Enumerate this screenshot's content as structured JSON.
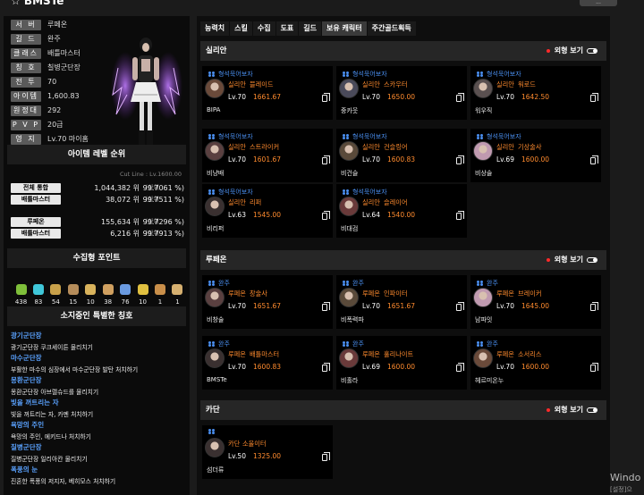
{
  "top": {
    "title": "☆ BMSTe",
    "button": "..."
  },
  "profile": {
    "rows": [
      {
        "key": "서 버",
        "val": "루페온"
      },
      {
        "key": "길 드",
        "val": "완주"
      },
      {
        "key": "클래스",
        "val": "배틀마스터"
      },
      {
        "key": "칭 호",
        "val": "칠병군단장"
      },
      {
        "key": "전 투",
        "val": "70"
      },
      {
        "key": "아이템",
        "val": "1,600.83"
      },
      {
        "key": "원정대",
        "val": "292"
      },
      {
        "key": "P V P",
        "val": "20급"
      },
      {
        "key": "영 지",
        "val": "Lv.70 마이홈"
      }
    ]
  },
  "rank": {
    "title": "아이템 레벨 순위",
    "cutline": "Cut Line : Lv.1600.00",
    "rows": [
      {
        "key": "전체 통합",
        "val": "1,044,382 위",
        "sep": "(상위",
        "pct": "99.7061 %)"
      },
      {
        "key": "배틀마스터",
        "val": "38,072 위",
        "sep": "(상위",
        "pct": "99.7511 %)"
      },
      {
        "key": "루페온",
        "val": "155,634 위",
        "sep": "(상위",
        "pct": "99.7296 %)"
      },
      {
        "key": "배틀마스터",
        "val": "6,216 위",
        "sep": "(상위",
        "pct": "99.7913 %)"
      }
    ]
  },
  "collect": {
    "title": "수집형 포인트",
    "items": [
      {
        "icon": "mokoko-seed-icon",
        "color": "#7fbf3a",
        "num": "438"
      },
      {
        "icon": "island-heart-icon",
        "color": "#3fc7d9",
        "num": "83"
      },
      {
        "icon": "art-icon",
        "color": "#c9a14a",
        "num": "54"
      },
      {
        "icon": "giants-heart-icon",
        "color": "#b68d5b",
        "num": "15"
      },
      {
        "icon": "ignea-token-icon",
        "color": "#d9b35c",
        "num": "10"
      },
      {
        "icon": "adventure-tome-icon",
        "color": "#d0a060",
        "num": "38"
      },
      {
        "icon": "world-tree-leaf-icon",
        "color": "#6a9ae0",
        "num": "76"
      },
      {
        "icon": "sea-bounty-icon",
        "color": "#e0c040",
        "num": "10"
      },
      {
        "icon": "orpheus-star-icon",
        "color": "#c98f4a",
        "num": "1"
      },
      {
        "icon": "omnium-star-icon",
        "color": "#d6b070",
        "num": "1"
      }
    ]
  },
  "titles": {
    "title": "소지중인 특별한 칭호",
    "items": [
      {
        "name": "광기군단장",
        "desc": "광기군단장 쿠크세이튼 물리치기"
      },
      {
        "name": "마수군단장",
        "desc": "부활한 마수의 심장에서 마수군단장 발탄 처치하기"
      },
      {
        "name": "몽환군단장",
        "desc": "몽환군단장 아브렐슈드를 물리치기"
      },
      {
        "name": "빛을 꺼트리는 자",
        "desc": "빛을 꺼트리는 자, 카멘 처치하기"
      },
      {
        "name": "욕망의 주인",
        "desc": "욕망의 주인, 에키드나 처치하기"
      },
      {
        "name": "질병군단장",
        "desc": "질병군단장 일리아칸 물리치기"
      },
      {
        "name": "폭풍의 눈",
        "desc": "진혼한 폭풍의 저지자, 베히모스 처치하기"
      }
    ]
  },
  "tabs": [
    "능력치",
    "스킬",
    "수집",
    "도표",
    "길드",
    "보유 캐릭터",
    "주간골드획득"
  ],
  "look_label": "외형 보기",
  "servers": [
    {
      "name": "실리안",
      "cards": [
        {
          "guild": "형석묵어보자",
          "srv": "실리안",
          "cls": "블레이드",
          "lv": "Lv.70",
          "ilv": "1661.67",
          "name": "BIPA"
        },
        {
          "guild": "형석묵어보자",
          "srv": "실리안",
          "cls": "스카우터",
          "lv": "Lv.70",
          "ilv": "1650.00",
          "name": "중카웃"
        },
        {
          "guild": "형석묵어보자",
          "srv": "실리안",
          "cls": "워로드",
          "lv": "Lv.70",
          "ilv": "1642.50",
          "name": "워우직"
        },
        {
          "guild": "형석묵어보자",
          "srv": "실리안",
          "cls": "스트라이커",
          "lv": "Lv.70",
          "ilv": "1601.67",
          "name": "비냥배"
        },
        {
          "guild": "형석묵어보자",
          "srv": "실리안",
          "cls": "건슬링어",
          "lv": "Lv.70",
          "ilv": "1600.83",
          "name": "비건슬"
        },
        {
          "guild": "형석묵어보자",
          "srv": "실리안",
          "cls": "기상술사",
          "lv": "Lv.69",
          "ilv": "1600.00",
          "name": "비상술"
        },
        {
          "guild": "형석묵어보자",
          "srv": "실리안",
          "cls": "리퍼",
          "lv": "Lv.63",
          "ilv": "1545.00",
          "name": "비리퍼"
        },
        {
          "guild": "형석묵어보자",
          "srv": "실리안",
          "cls": "슬레이어",
          "lv": "Lv.64",
          "ilv": "1540.00",
          "name": "비대검"
        }
      ]
    },
    {
      "name": "루페온",
      "cards": [
        {
          "guild": "완주",
          "srv": "루페온",
          "cls": "창술사",
          "lv": "Lv.70",
          "ilv": "1651.67",
          "name": "비창술"
        },
        {
          "guild": "완주",
          "srv": "루페온",
          "cls": "인파이터",
          "lv": "Lv.70",
          "ilv": "1651.67",
          "name": "비폭력파"
        },
        {
          "guild": "완주",
          "srv": "루페온",
          "cls": "브레이커",
          "lv": "Lv.70",
          "ilv": "1645.00",
          "name": "남파잇"
        },
        {
          "guild": "완주",
          "srv": "루페온",
          "cls": "배틀마스터",
          "lv": "Lv.70",
          "ilv": "1600.83",
          "name": "BMSTe"
        },
        {
          "guild": "완주",
          "srv": "루페온",
          "cls": "홀리나이트",
          "lv": "Lv.69",
          "ilv": "1600.00",
          "name": "비홀라"
        },
        {
          "guild": "완주",
          "srv": "루페온",
          "cls": "소서리스",
          "lv": "Lv.70",
          "ilv": "1600.00",
          "name": "헤르미온누"
        }
      ]
    },
    {
      "name": "카단",
      "cards": [
        {
          "guild": "",
          "srv": "카단",
          "cls": "소울이터",
          "lv": "Lv.50",
          "ilv": "1325.00",
          "name": "섬더류"
        }
      ]
    }
  ],
  "windows": {
    "line1": "Windo",
    "line2": "[설정]으"
  }
}
